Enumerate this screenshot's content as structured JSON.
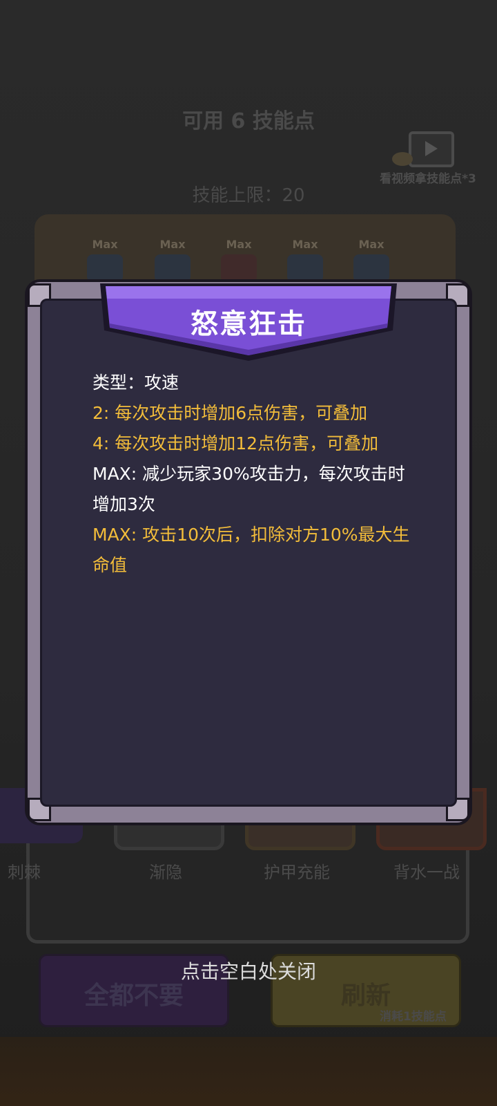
{
  "background": {
    "skill_points_title": "可用 6 技能点",
    "skill_limit": "技能上限：20",
    "video_reward_label": "看视频拿技能点*3",
    "book_slots": [
      {
        "badge": "Max"
      },
      {
        "badge": "Max"
      },
      {
        "badge": "Max"
      },
      {
        "badge": "Max"
      },
      {
        "badge": "Max"
      }
    ],
    "skill_cards": [
      {
        "name": "刺棘"
      },
      {
        "name": "渐隐"
      },
      {
        "name": "护甲充能"
      },
      {
        "name": "背水一战"
      }
    ],
    "reject_all_label": "全都不要",
    "refresh_label": "刷新",
    "refresh_cost": "消耗1技能点"
  },
  "dialog": {
    "title": "怒意狂击",
    "lines": [
      {
        "text": "类型：攻速",
        "color": "white"
      },
      {
        "text": "2: 每次攻击时增加6点伤害，可叠加",
        "color": "gold"
      },
      {
        "text": "4: 每次攻击时增加12点伤害，可叠加",
        "color": "gold"
      },
      {
        "text": "MAX: 减少玩家30%攻击力，每次攻击时增加3次",
        "color": "white"
      },
      {
        "text": "MAX: 攻击10次后，扣除对方10%最大生命值",
        "color": "gold"
      }
    ],
    "close_hint": "点击空白处关闭"
  },
  "colors": {
    "banner_purple": "#7a4fd6",
    "panel_dark": "#2e2b3f",
    "frame_gray": "#8d8297",
    "text_gold": "#f3bd3a"
  }
}
